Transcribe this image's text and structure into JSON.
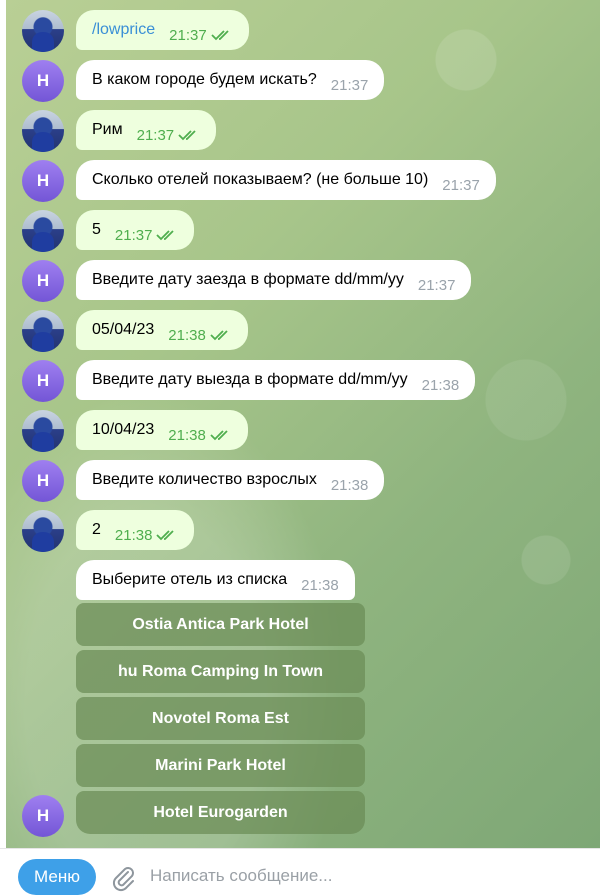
{
  "bot_initial": "Н",
  "messages": [
    {
      "side": "out",
      "text": "/lowprice",
      "time": "21:37",
      "link": true
    },
    {
      "side": "in",
      "text": "В каком городе будем искать?",
      "time": "21:37"
    },
    {
      "side": "out",
      "text": "Рим",
      "time": "21:37"
    },
    {
      "side": "in",
      "text": "Сколько отелей показываем? (не больше 10)",
      "time": "21:37"
    },
    {
      "side": "out",
      "text": "5",
      "time": "21:37"
    },
    {
      "side": "in",
      "text": "Введите дату заезда в формате dd/mm/yy",
      "time": "21:37"
    },
    {
      "side": "out",
      "text": "05/04/23",
      "time": "21:38"
    },
    {
      "side": "in",
      "text": "Введите дату выезда в формате dd/mm/yy",
      "time": "21:38"
    },
    {
      "side": "out",
      "text": "10/04/23",
      "time": "21:38"
    },
    {
      "side": "in",
      "text": "Введите количество взрослых",
      "time": "21:38"
    },
    {
      "side": "out",
      "text": "2",
      "time": "21:38"
    },
    {
      "side": "in",
      "text": "Выберите отель из списка",
      "time": "21:38"
    }
  ],
  "keyboard": [
    "Ostia Antica Park Hotel",
    "hu Roma Camping In Town",
    "Novotel Roma Est",
    "Marini Park Hotel",
    "Hotel Eurogarden"
  ],
  "composer": {
    "menu_label": "Меню",
    "placeholder": "Написать сообщение..."
  },
  "colors": {
    "outgoing_bubble": "#eeffde",
    "incoming_bubble": "#ffffff",
    "bot_avatar": "#7356d6",
    "menu_button": "#3ea0e8",
    "keyboard_button": "#6b8c56"
  }
}
